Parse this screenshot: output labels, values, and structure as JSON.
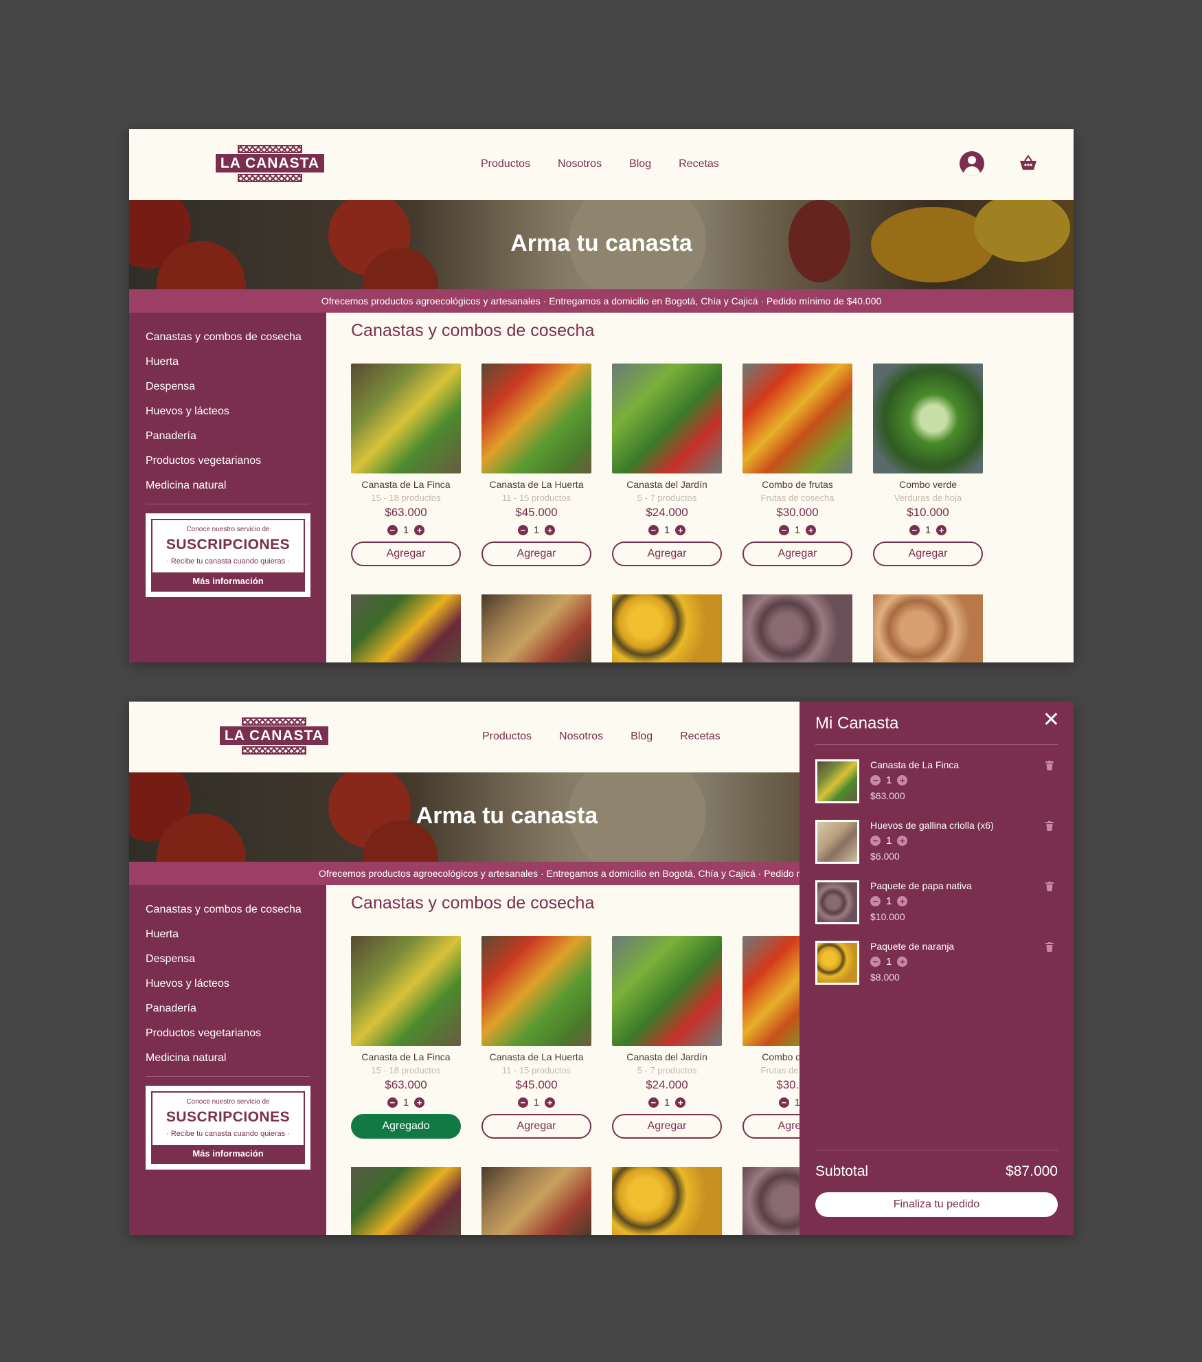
{
  "brand": {
    "name": "LA CANASTA"
  },
  "nav": [
    "Productos",
    "Nosotros",
    "Blog",
    "Recetas"
  ],
  "icons": {
    "user": "user-icon",
    "basket": "basket-icon",
    "close": "close-icon",
    "trash": "trash-icon"
  },
  "hero": {
    "title": "Arma tu canasta"
  },
  "strip": "Ofrecemos productos agroecológicos y artesanales · Entregamos a domicilio en Bogotá, Chía y Cajicá · Pedido mínimo de $40.000",
  "sidebar": {
    "items": [
      "Canastas y combos de cosecha",
      "Huerta",
      "Despensa",
      "Huevos y lácteos",
      "Panadería",
      "Productos vegetarianos",
      "Medicina natural"
    ],
    "subscription": {
      "line1": "Conoce nuestro servicio de",
      "headline": "SUSCRIPCIONES",
      "line2": "· Recibe tu canasta cuando quieras ·",
      "button": "Más información"
    }
  },
  "section_title": "Canastas y combos de cosecha",
  "products": [
    {
      "name": "Canasta de La Finca",
      "sub": "15 - 18 productos",
      "price": "$63.000",
      "qty": "1"
    },
    {
      "name": "Canasta de La Huerta",
      "sub": "11 - 15 productos",
      "price": "$45.000",
      "qty": "1"
    },
    {
      "name": "Canasta del Jardín",
      "sub": "5 - 7 productos",
      "price": "$24.000",
      "qty": "1"
    },
    {
      "name": "Combo de frutas",
      "sub": "Frutas de cosecha",
      "price": "$30.000",
      "qty": "1"
    },
    {
      "name": "Combo verde",
      "sub": "Verduras de hoja",
      "price": "$10.000",
      "qty": "1"
    }
  ],
  "buttons": {
    "add": "Agregar",
    "added": "Agregado"
  },
  "qty_controls": {
    "minus": "−",
    "plus": "+"
  },
  "cart": {
    "title": "Mi Canasta",
    "close": "✕",
    "items": [
      {
        "name": "Canasta de La Finca",
        "qty": "1",
        "price": "$63.000"
      },
      {
        "name": "Huevos de gallina criolla (x6)",
        "qty": "1",
        "price": "$6.000"
      },
      {
        "name": "Paquete de papa nativa",
        "qty": "1",
        "price": "$10.000"
      },
      {
        "name": "Paquete de naranja",
        "qty": "1",
        "price": "$8.000"
      }
    ],
    "subtotal_label": "Subtotal",
    "subtotal_value": "$87.000",
    "checkout": "Finaliza tu pedido"
  },
  "colors": {
    "brand": "#7a2f4e",
    "strip": "#9b3f65",
    "added": "#117a44",
    "background": "#fdfaf2"
  }
}
